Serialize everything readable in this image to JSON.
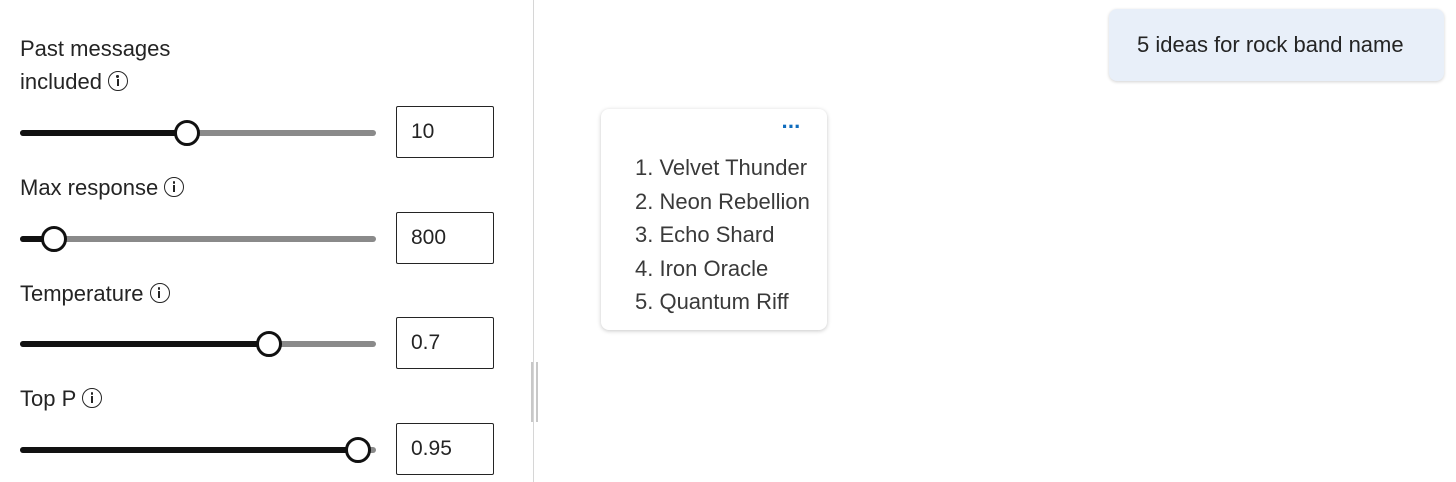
{
  "params": {
    "past_messages": {
      "label_line1": "Past messages",
      "label_line2": "included",
      "value": "10",
      "fraction": 0.47
    },
    "max_response": {
      "label": "Max response",
      "value": "800",
      "fraction": 0.095
    },
    "temperature": {
      "label": "Temperature",
      "value": "0.7",
      "fraction": 0.7
    },
    "top_p": {
      "label": "Top P",
      "value": "0.95",
      "fraction": 0.95
    }
  },
  "chat": {
    "user_message": "5 ideas for rock band name",
    "assistant_more": "···",
    "ideas": [
      "1. Velvet Thunder",
      "2. Neon Rebellion",
      "3. Echo Shard",
      "4. Iron Oracle",
      "5. Quantum Riff"
    ]
  },
  "colors": {
    "accent": "#0f6cbd",
    "user_bubble": "#e8eff9",
    "slider_active": "#111111",
    "slider_inactive": "#8a8a8a"
  },
  "icons": {
    "info": "info-icon",
    "more": "more-icon"
  }
}
